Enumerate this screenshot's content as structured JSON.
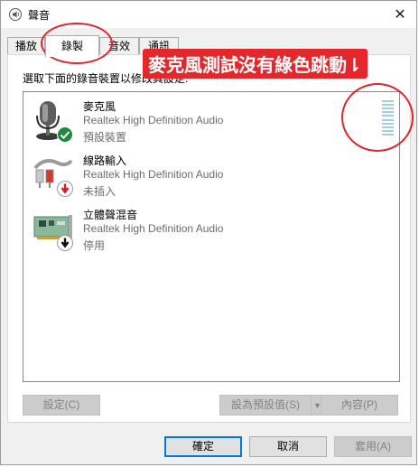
{
  "window": {
    "title": "聲音",
    "close_glyph": "✕"
  },
  "tabs": [
    {
      "label": "播放"
    },
    {
      "label": "錄製"
    },
    {
      "label": "音效"
    },
    {
      "label": "通訊"
    }
  ],
  "panel": {
    "instruction": "選取下面的錄音裝置以修改其設定:"
  },
  "devices": [
    {
      "name": "麥克風",
      "driver": "Realtek High Definition Audio",
      "status": "預設裝置",
      "icon": "microphone-icon",
      "badge": "check-badge-icon"
    },
    {
      "name": "線路輸入",
      "driver": "Realtek High Definition Audio",
      "status": "未插入",
      "icon": "line-in-icon",
      "badge": "down-arrow-red-badge-icon"
    },
    {
      "name": "立體聲混音",
      "driver": "Realtek High Definition Audio",
      "status": "停用",
      "icon": "sound-card-icon",
      "badge": "down-arrow-black-badge-icon"
    }
  ],
  "panel_buttons": {
    "configure": "設定(C)",
    "set_default": "設為預設值(S)",
    "properties": "內容(P)"
  },
  "dialog_buttons": {
    "ok": "確定",
    "cancel": "取消",
    "apply": "套用(A)"
  },
  "annotation": {
    "text": "麥克風測試沒有綠色跳動⇂"
  },
  "colors": {
    "accent": "#0078d7",
    "annotation": "#e4272b",
    "level_meter": "#a8cde0"
  }
}
